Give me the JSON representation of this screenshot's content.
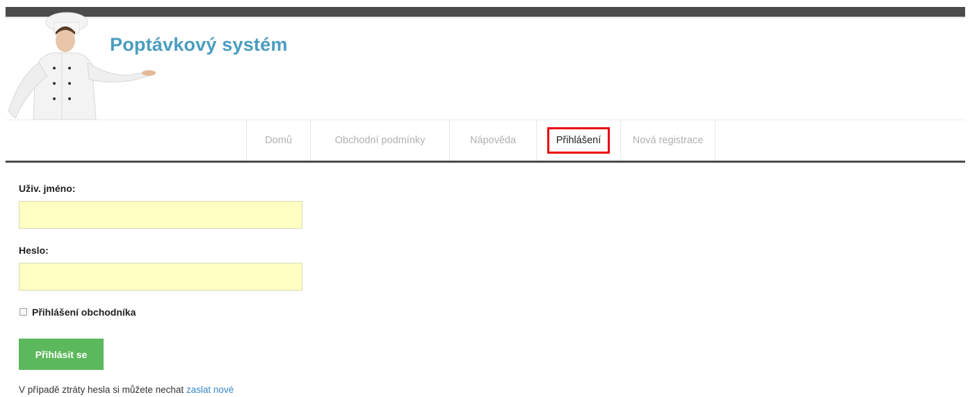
{
  "site": {
    "title": "Poptávkový systém"
  },
  "nav": {
    "items": [
      {
        "label": "Domů"
      },
      {
        "label": "Obchodní podmínky"
      },
      {
        "label": "Nápověda"
      },
      {
        "label": "Přihlášení"
      },
      {
        "label": "Nová registrace"
      }
    ],
    "active": "Přihlášení"
  },
  "form": {
    "username_label": "Uživ. jméno:",
    "username_value": "",
    "password_label": "Heslo:",
    "password_value": "",
    "merchant_checkbox_label": "Přihlášení obchodníka",
    "merchant_checked": false,
    "submit_label": "Přihlásit se"
  },
  "footer": {
    "text": "V případě ztráty hesla si můžete nechat",
    "link_text": "zaslat nové"
  },
  "colors": {
    "title": "#4a9dc0",
    "nav_highlight": "#e8000d",
    "input_bg": "#ffffc3",
    "button_bg": "#5cb85c",
    "link": "#3a87c8"
  }
}
